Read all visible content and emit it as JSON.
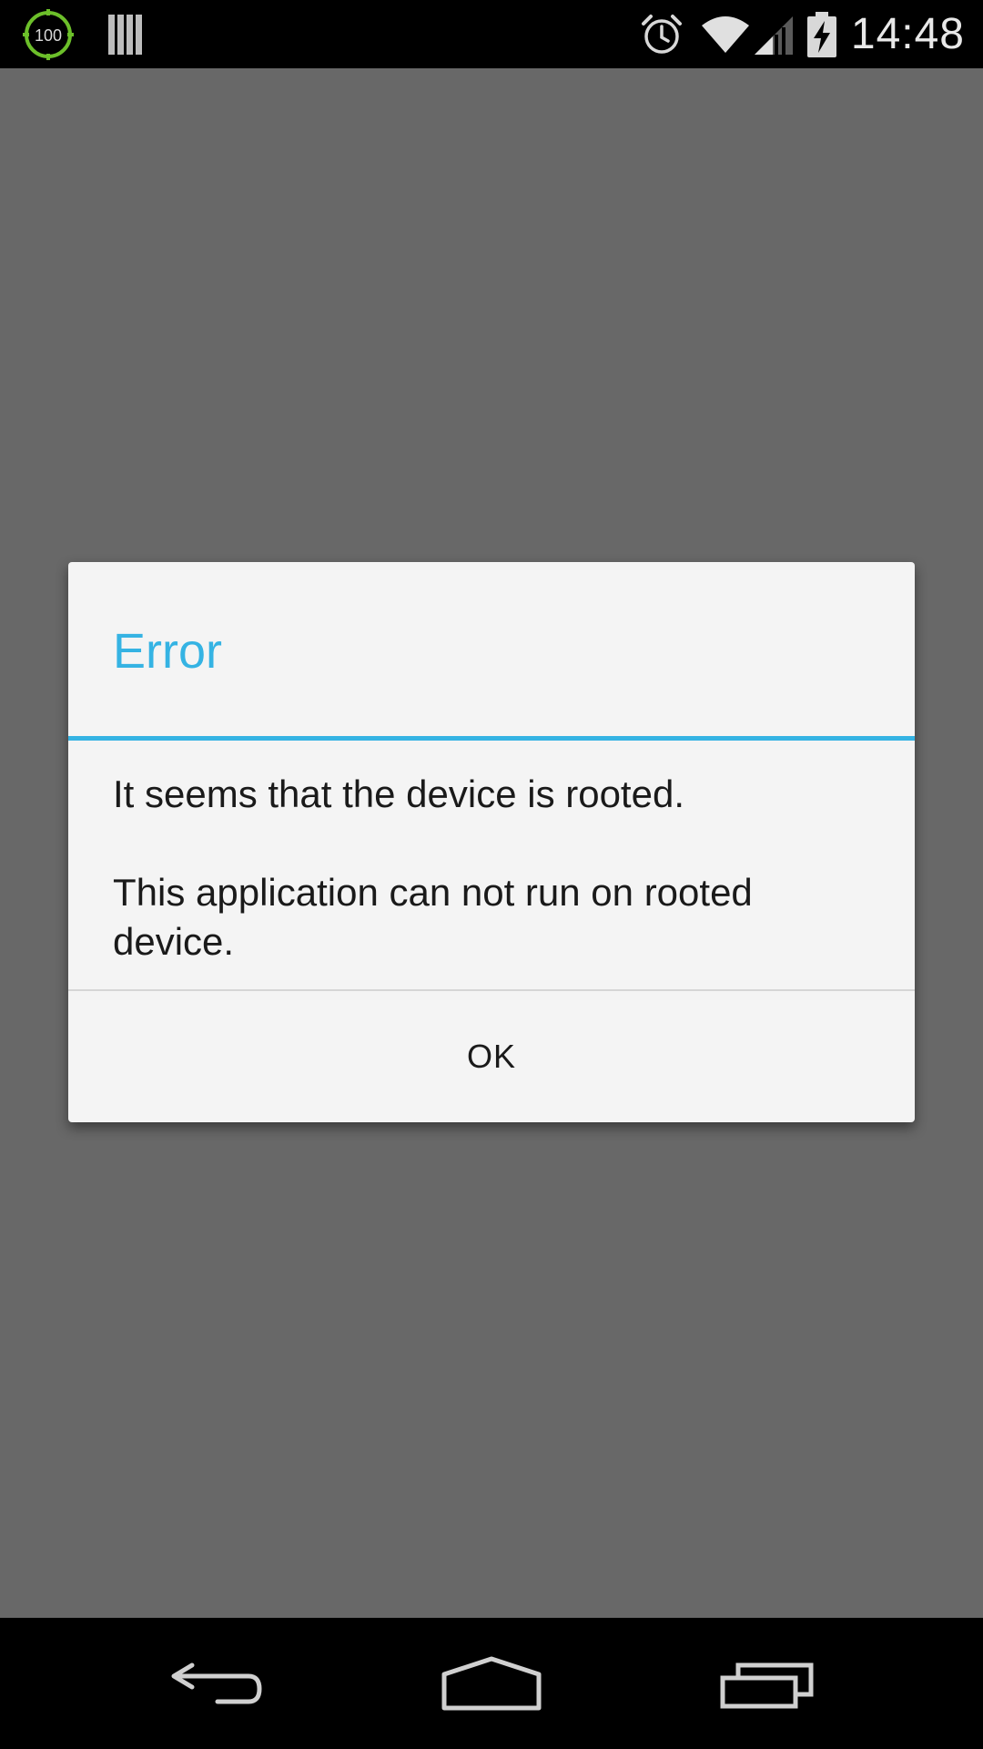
{
  "status_bar": {
    "battery_widget_value": "100",
    "battery_widget_icon": "battery-percent-widget-icon",
    "barcode_icon": "barcode-icon",
    "alarm_icon": "alarm-icon",
    "wifi_icon": "wifi-icon",
    "signal_icon": "cell-signal-icon",
    "battery_icon": "battery-charging-icon",
    "time": "14:48"
  },
  "dialog": {
    "title": "Error",
    "message_line1": "It seems that the device is rooted.",
    "message_line2": "This application can not run on rooted device.",
    "ok_label": "OK",
    "accent_color": "#35b3e3"
  },
  "nav_bar": {
    "back_icon": "back-icon",
    "home_icon": "home-icon",
    "recents_icon": "recents-icon"
  }
}
